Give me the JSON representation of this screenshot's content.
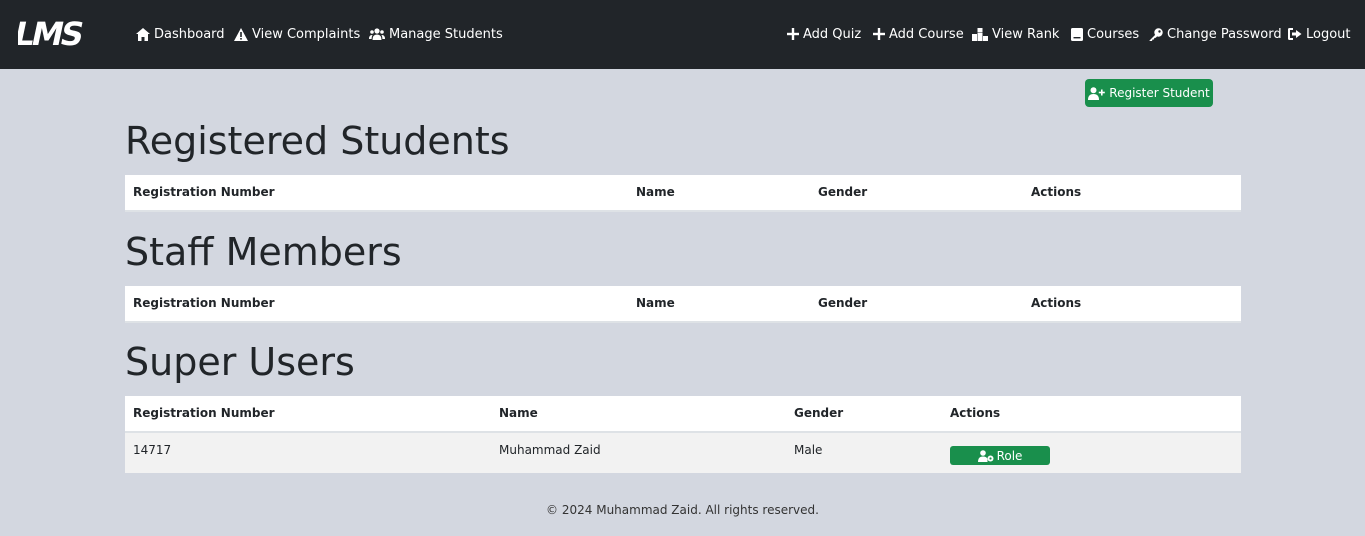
{
  "brand": {
    "logo_text": "LMS"
  },
  "nav": {
    "left": [
      {
        "label": "Dashboard",
        "icon": "home-icon"
      },
      {
        "label": "View Complaints",
        "icon": "warning-icon"
      },
      {
        "label": "Manage Students",
        "icon": "users-icon"
      }
    ],
    "right": [
      {
        "label": "Add Quiz",
        "icon": "plus-icon"
      },
      {
        "label": "Add Course",
        "icon": "plus-icon"
      },
      {
        "label": "View Rank",
        "icon": "ranking-icon"
      },
      {
        "label": "Courses",
        "icon": "book-icon"
      },
      {
        "label": "Change Password",
        "icon": "key-icon"
      },
      {
        "label": "Logout",
        "icon": "logout-icon"
      }
    ]
  },
  "register_button": {
    "label": "Register Student",
    "icon": "user-plus-icon"
  },
  "sections": {
    "students": {
      "title": "Registered Students",
      "columns": [
        "Registration Number",
        "Name",
        "Gender",
        "Actions"
      ],
      "rows": []
    },
    "staff": {
      "title": "Staff Members",
      "columns": [
        "Registration Number",
        "Name",
        "Gender",
        "Actions"
      ],
      "rows": []
    },
    "super_users": {
      "title": "Super Users",
      "columns": [
        "Registration Number",
        "Name",
        "Gender",
        "Actions"
      ],
      "rows": [
        {
          "registration_number": "14717",
          "name": "Muhammad Zaid",
          "gender": "Male",
          "action_label": "Role",
          "action_icon": "user-gear-icon"
        }
      ]
    }
  },
  "footer": {
    "text": "© 2024 Muhammad Zaid. All rights reserved."
  },
  "colors": {
    "navbar": "#212529",
    "background": "#d3d7e0",
    "success": "#198f4c",
    "row_alt": "#f2f2f2"
  }
}
